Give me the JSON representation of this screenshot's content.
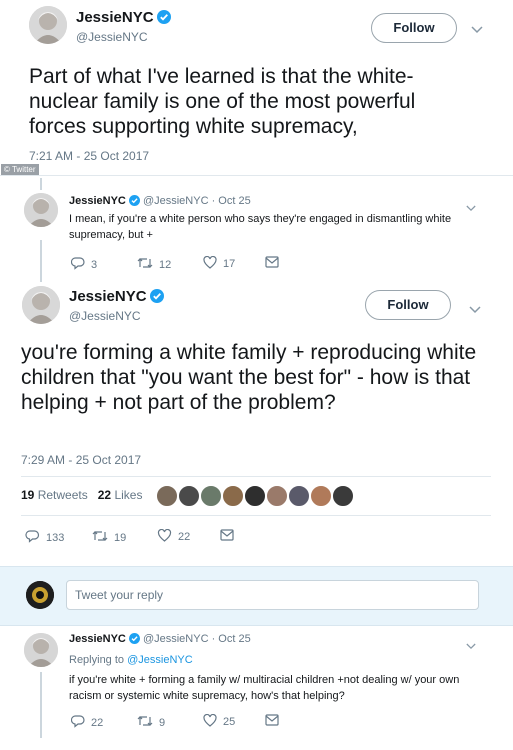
{
  "tweet1": {
    "name": "JessieNYC",
    "handle": "@JessieNYC",
    "follow_label": "Follow",
    "text": "Part of what I've learned is that the white-nuclear family is one of the most powerful forces supporting white supremacy,",
    "time": "7:21 AM - 25 Oct 2017",
    "watermark": "© Twitter"
  },
  "reply1": {
    "name": "JessieNYC",
    "handle": "@JessieNYC",
    "date": "· Oct 25",
    "text": "I mean, if you're a white person who says they're engaged in dismantling white supremacy, but +",
    "replies": "3",
    "retweets": "12",
    "likes": "17"
  },
  "tweet2": {
    "name": "JessieNYC",
    "handle": "@JessieNYC",
    "follow_label": "Follow",
    "text": "you're forming a white family + reproducing white children that \"you want the best for\" - how is that helping + not part of the problem?",
    "time": "7:29 AM - 25 Oct 2017",
    "retweets_count": "19",
    "retweets_label": "Retweets",
    "likes_count": "22",
    "likes_label": "Likes",
    "replies": "133",
    "retweets": "19",
    "likes": "22"
  },
  "reply_compose": {
    "placeholder": "Tweet your reply"
  },
  "reply2": {
    "name": "JessieNYC",
    "handle": "@JessieNYC",
    "date": "· Oct 25",
    "replying_prefix": "Replying to",
    "replying_to": "@JessieNYC",
    "text": "if you're white + forming a family w/ multiracial children +not dealing w/ your own racism or systemic white supremacy, how's that helping?",
    "replies": "22",
    "retweets": "9",
    "likes": "25"
  },
  "colors": {
    "verified": "#1da1f2",
    "link": "#1b95e0",
    "muted": "#657786"
  },
  "icons": [
    "verified-icon",
    "chevron-down-icon",
    "reply-icon",
    "retweet-icon",
    "like-icon",
    "message-icon"
  ]
}
